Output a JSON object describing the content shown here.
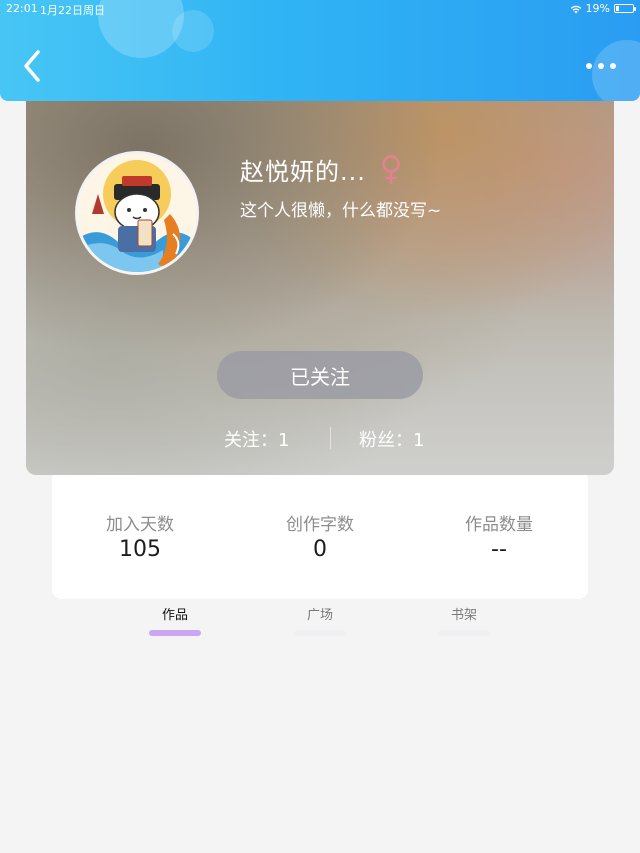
{
  "status_bar": {
    "time": "22:01",
    "date": "1月22日周日",
    "battery": "19%",
    "battery_level": 0.19
  },
  "header": {
    "back_icon": "chevron-left-icon",
    "more_icon": "more-dots-icon"
  },
  "profile": {
    "name": "赵悦妍的...",
    "gender_icon": "female-icon",
    "bio": "这个人很懒，什么都没写~",
    "follow_button": "已关注",
    "following": "关注：1",
    "fans": "粉丝：1"
  },
  "stats": [
    {
      "label": "加入天数",
      "value": "105"
    },
    {
      "label": "创作字数",
      "value": "0"
    },
    {
      "label": "作品数量",
      "value": "--"
    }
  ],
  "tabs": [
    {
      "label": "作品",
      "active": true
    },
    {
      "label": "广场",
      "active": false
    },
    {
      "label": "书架",
      "active": false
    }
  ],
  "colors": {
    "header_start": "#47c6f5",
    "header_end": "#2a9df2",
    "female_icon": "#e8818f",
    "tab_active_underline": "#c9a7f2"
  }
}
